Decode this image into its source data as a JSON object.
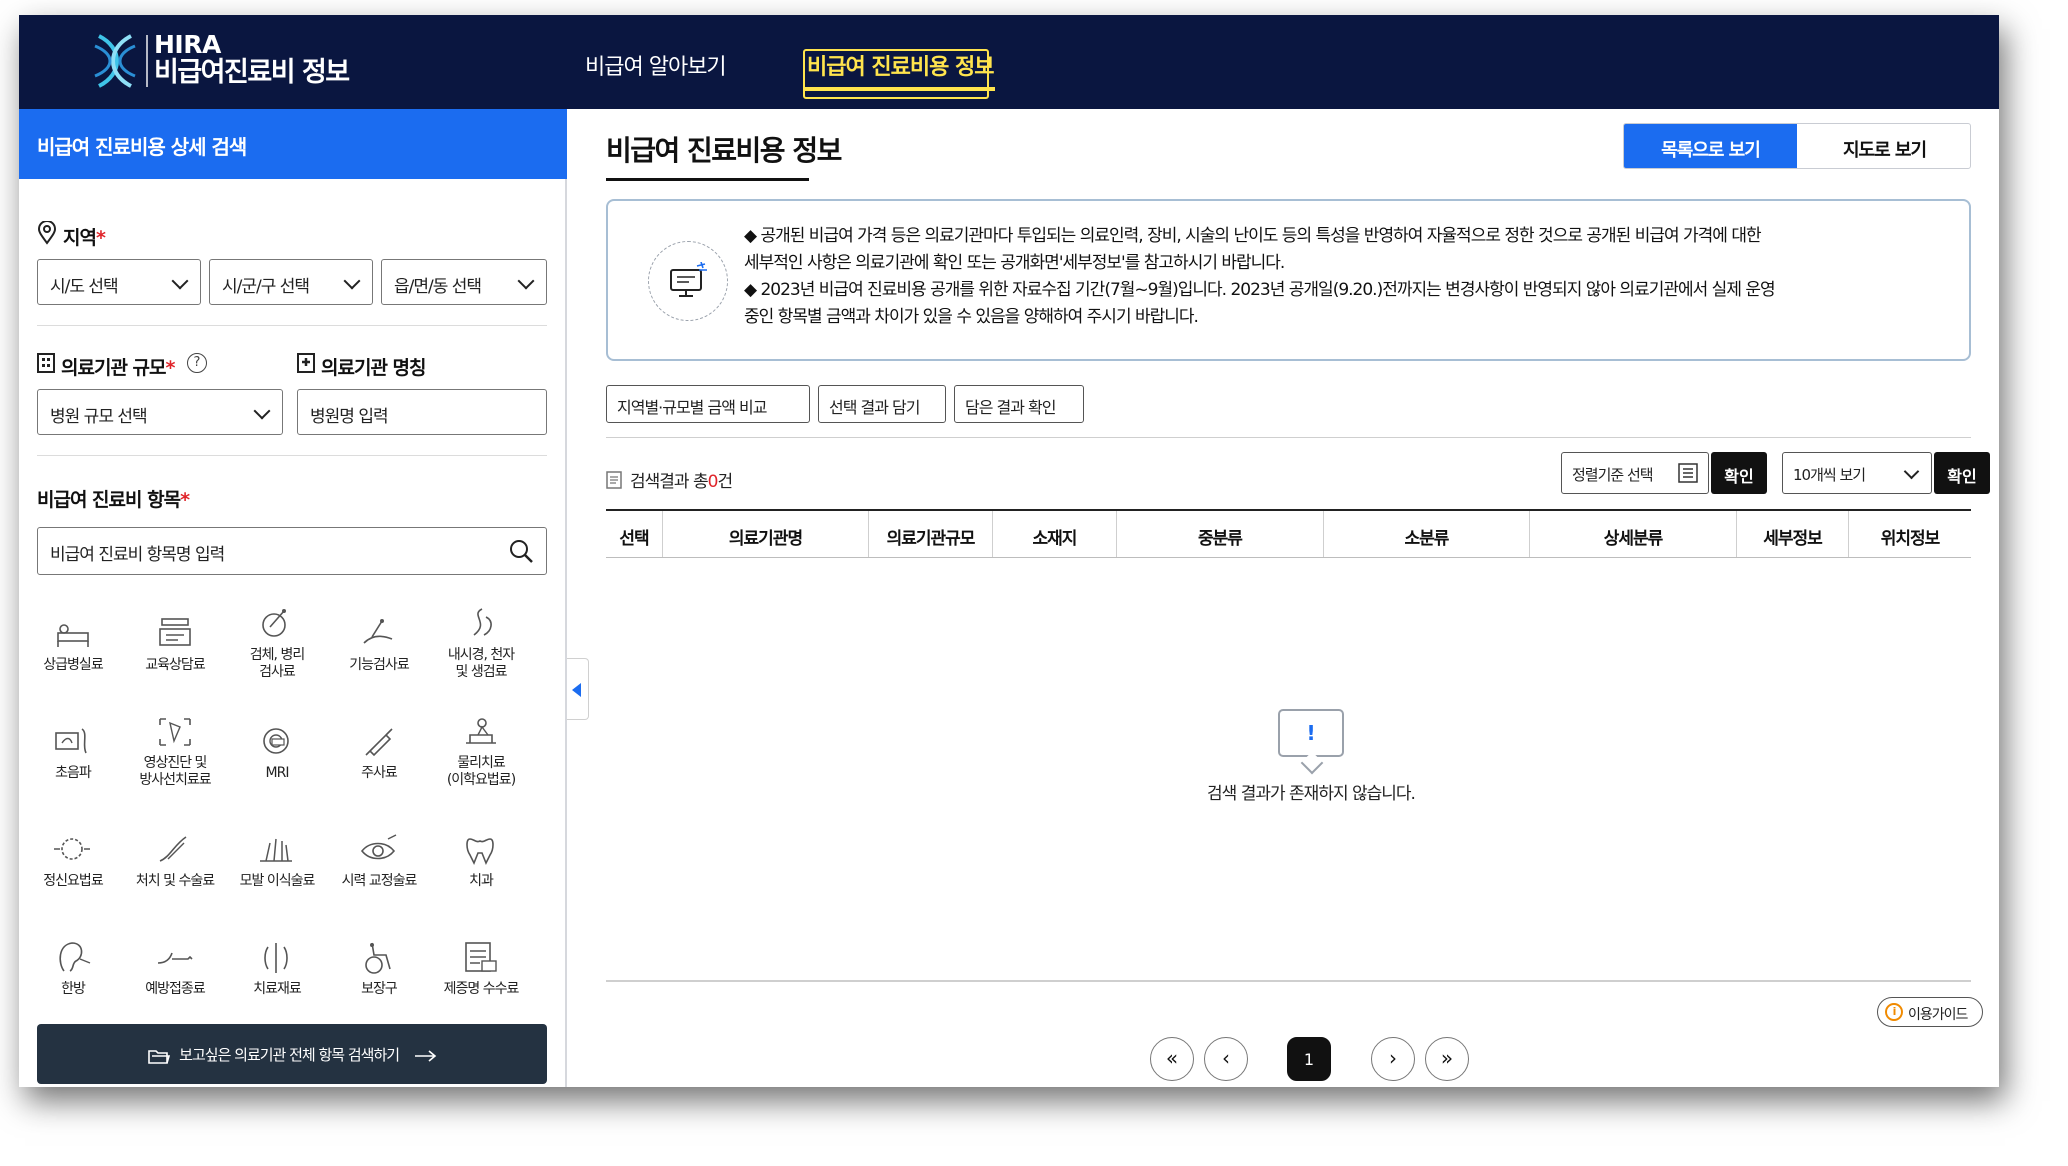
{
  "header": {
    "brand": "HIRA",
    "subtitle": "비급여진료비 정보",
    "nav": [
      "비급여 알아보기",
      "비급여 진료비용 정보"
    ]
  },
  "sidebar": {
    "title": "비급여 진료비용 상세 검색",
    "region_label": "지역",
    "region_selects": [
      "시/도 선택",
      "시/군/구 선택",
      "읍/면/동 선택"
    ],
    "scale_label": "의료기관 규모",
    "scale_select": "병원 규모 선택",
    "name_label": "의료기관 명칭",
    "name_placeholder": "병원명 입력",
    "item_label": "비급여 진료비 항목",
    "item_placeholder": "비급여 진료비 항목명 입력",
    "categories": [
      "상급병실료",
      "교육상담료",
      "검체, 병리\n검사료",
      "기능검사료",
      "내시경, 천자\n및 생검료",
      "초음파",
      "영상진단 및\n방사선치료료",
      "MRI",
      "주사료",
      "물리치료\n(이학요법료)",
      "정신요법료",
      "처치 및 수술료",
      "모발 이식술료",
      "시력 교정술료",
      "치과",
      "한방",
      "예방접종료",
      "치료재료",
      "보장구",
      "제증명 수수료"
    ],
    "all_button": "보고싶은 의료기관 전체 항목 검색하기"
  },
  "main": {
    "title": "비급여 진료비용 정보",
    "view_list": "목록으로 보기",
    "view_map": "지도로 보기",
    "notice_lines": [
      "◆ 공개된 비급여 가격 등은 의료기관마다 투입되는 의료인력, 장비, 시술의 난이도 등의 특성을 반영하여 자율적으로 정한 것으로 공개된 비급여 가격에 대한",
      "세부적인 사항은 의료기관에 확인 또는 공개화면'세부정보'를 참고하시기 바랍니다.",
      "◆ 2023년 비급여 진료비용 공개를 위한 자료수집 기간(7월~9월)입니다. 2023년 공개일(9.20.)전까지는 변경사항이 반영되지 않아 의료기관에서 실제 운영",
      "중인 항목별 금액과 차이가 있을 수 있음을 양해하여 주시기 바랍니다."
    ],
    "tools": [
      "지역별·규모별 금액 비교",
      "선택 결과 담기",
      "담은 결과 확인"
    ],
    "result_prefix": "검색결과 총",
    "result_count": "0",
    "result_suffix": "건",
    "sort_select": "정렬기준 선택",
    "confirm": "확인",
    "page_size": "10개씩 보기",
    "columns": [
      "선택",
      "의료기관명",
      "의료기관규모",
      "소재지",
      "중분류",
      "소분류",
      "상세분류",
      "세부정보",
      "위치정보"
    ],
    "empty_text": "검색 결과가 존재하지 않습니다.",
    "guide": "이용가이드",
    "current_page": "1"
  },
  "colors": {
    "navy": "#0a1640",
    "accent": "#1b6cf0",
    "highlight": "#ffe44d",
    "required": "#e0242a"
  }
}
